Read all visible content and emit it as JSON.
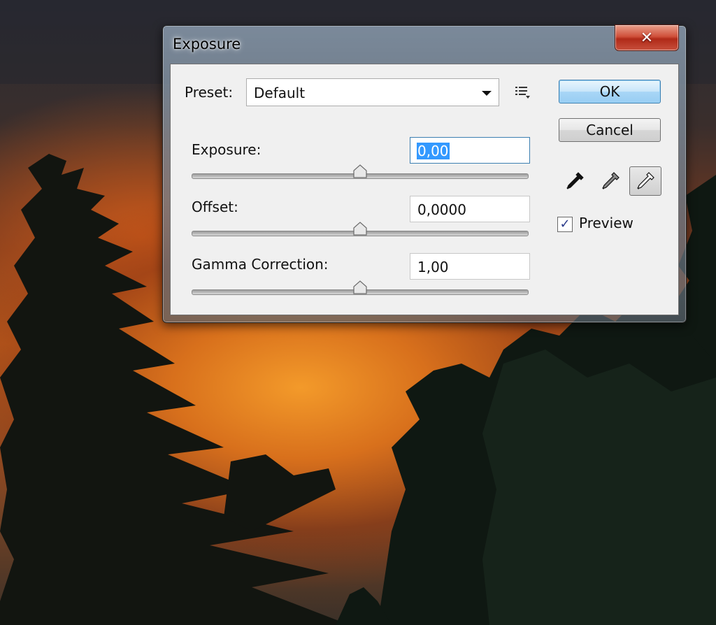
{
  "dialog": {
    "title": "Exposure",
    "close_glyph": "✕"
  },
  "preset": {
    "label": "Preset:",
    "selected": "Default"
  },
  "controls": [
    {
      "label": "Exposure:",
      "value": "0,00",
      "slider_fraction": 0.5
    },
    {
      "label": "Offset:",
      "value": "0,0000",
      "slider_fraction": 0.5
    },
    {
      "label": "Gamma Correction:",
      "value": "1,00",
      "slider_fraction": 0.5
    }
  ],
  "buttons": {
    "ok": "OK",
    "cancel": "Cancel"
  },
  "eyedroppers": [
    "eyedropper-black-icon",
    "eyedropper-gray-icon",
    "eyedropper-white-icon"
  ],
  "preview": {
    "label": "Preview",
    "checked": true
  },
  "colors": {
    "accent": "#3399ff",
    "close_red": "#c8402a"
  }
}
